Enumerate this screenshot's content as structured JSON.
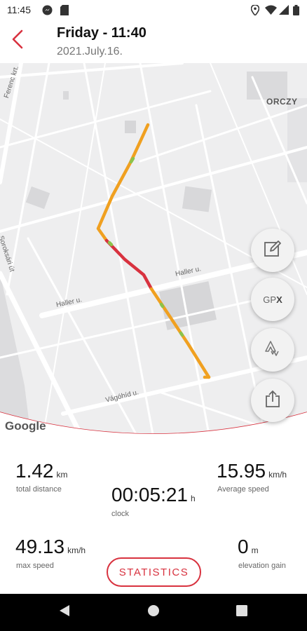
{
  "status_bar": {
    "time": "11:45",
    "left_icons": [
      "messenger-icon",
      "sd-card-icon"
    ],
    "right_icons": [
      "location-icon",
      "wifi-icon",
      "signal-icon",
      "battery-icon"
    ]
  },
  "header": {
    "back_icon": "chevron-left-icon",
    "title": "Friday - 11:40",
    "subtitle": "2021.July.16."
  },
  "map": {
    "labels": {
      "ferenc": "Ferenc krt.",
      "orczy": "ORCZY",
      "soroksari": "Soroksári út",
      "haller_1": "Haller u.",
      "haller_2": "Haller u.",
      "vagohid": "Vágóhíd u."
    },
    "attribution": "Google",
    "route_colors": {
      "slow": "#d8323f",
      "medium": "#f0a020",
      "fast": "#8bc34a"
    },
    "fab_buttons": [
      {
        "name": "edit",
        "icon": "edit-icon"
      },
      {
        "name": "gpx",
        "label_left": "GP",
        "label_right": "X"
      },
      {
        "name": "strava",
        "icon": "strava-icon"
      },
      {
        "name": "share",
        "icon": "share-icon"
      }
    ]
  },
  "stats": {
    "total_distance": {
      "value": "1.42",
      "unit": "km",
      "label": "total distance"
    },
    "average_speed": {
      "value": "15.95",
      "unit": "km/h",
      "label": "Average speed"
    },
    "clock": {
      "value": "00:05:21",
      "unit": "h",
      "label": "clock"
    },
    "max_speed": {
      "value": "49.13",
      "unit": "km/h",
      "label": "max speed"
    },
    "elevation_gain": {
      "value": "0",
      "unit": "m",
      "label": "elevation gain"
    },
    "button_label": "STATISTICS"
  },
  "colors": {
    "accent": "#d8323f",
    "map_background": "#eeeeef"
  },
  "nav_bar": {
    "buttons": [
      "back-icon",
      "home-icon",
      "recents-icon"
    ]
  }
}
